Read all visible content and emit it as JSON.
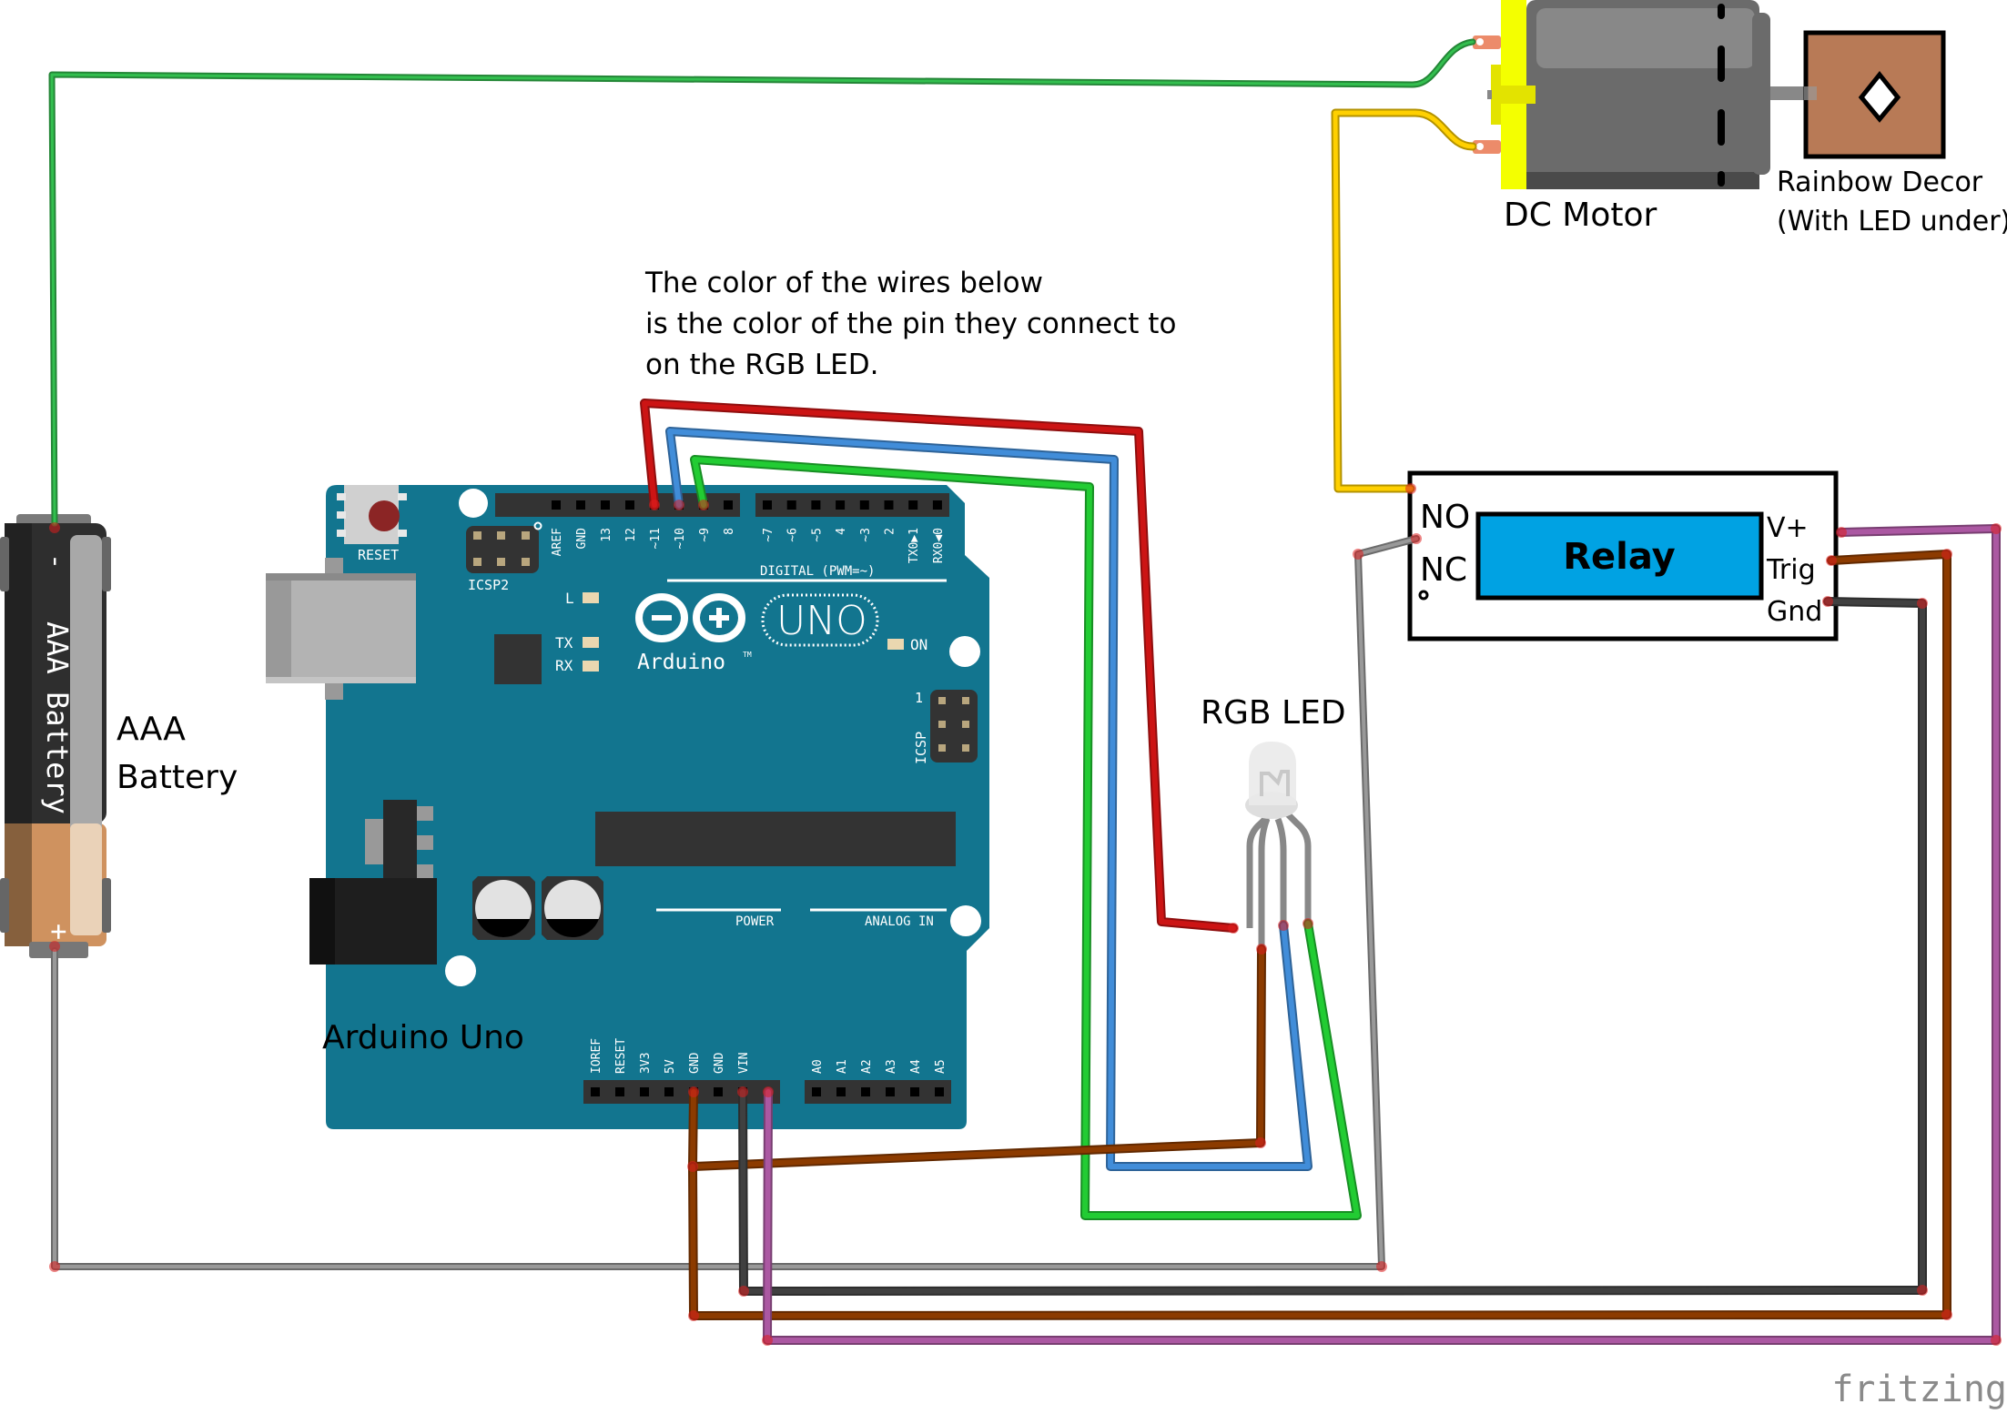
{
  "labels": {
    "note_line1": "The color of the wires below",
    "note_line2": "is the color of the pin they connect to",
    "note_line3": "on the RGB LED.",
    "dc_motor": "DC Motor",
    "rainbow_decor_line1": "Rainbow Decor",
    "rainbow_decor_line2": "(With LED under)",
    "aaa_line1": "AAA",
    "aaa_line2": "Battery",
    "battery_body": "AAA Battery",
    "battery_minus": "-",
    "battery_plus": "+",
    "rgb_led": "RGB LED",
    "arduino_uno": "Arduino Uno",
    "relay_title": "Relay",
    "relay_no": "NO",
    "relay_nc": "NC",
    "relay_vplus": "V+",
    "relay_trig": "Trig",
    "relay_gnd": "Gnd",
    "fritzing": "fritzing"
  },
  "arduino": {
    "reset": "RESET",
    "icsp2": "ICSP2",
    "icsp": "ICSP",
    "icsp_pin1": "1",
    "digital": "DIGITAL (PWM=~)",
    "power": "POWER",
    "analog": "ANALOG IN",
    "led_l": "L",
    "led_tx": "TX",
    "led_rx": "RX",
    "led_on": "ON",
    "brand": "Arduino",
    "tm": "TM",
    "model": "UNO",
    "top_pins_a": [
      "AREF",
      "GND",
      "13",
      "12",
      "~11",
      "~10",
      "~9",
      "8"
    ],
    "top_pins_b": [
      "~7",
      "~6",
      "~5",
      "4",
      "~3",
      "2",
      "TX0▶1",
      "RX0◀0"
    ],
    "power_pins": [
      "IOREF",
      "RESET",
      "3V3",
      "5V",
      "GND",
      "GND",
      "VIN"
    ],
    "analog_pins": [
      "A0",
      "A1",
      "A2",
      "A3",
      "A4",
      "A5"
    ]
  },
  "wires": [
    {
      "name": "battery-minus-to-motor-wire",
      "color": "#33bf4f"
    },
    {
      "name": "motor-to-relay-no-wire",
      "color": "#ffd000"
    },
    {
      "name": "relay-nc-to-battery-plus-wire",
      "color": "#999999"
    },
    {
      "name": "pin11-to-led-red-wire",
      "color": "#cc1414"
    },
    {
      "name": "pin10-to-led-blue-wire",
      "color": "#418dd9"
    },
    {
      "name": "pin9-to-led-green-wire",
      "color": "#22cc33"
    },
    {
      "name": "5v-to-led-common-wire",
      "color": "#8c3b00"
    },
    {
      "name": "5v-to-relay-trig-wire",
      "color": "#8c3b00"
    },
    {
      "name": "gnd-to-relay-gnd-wire",
      "color": "#404040"
    },
    {
      "name": "vin-to-relay-vplus-wire",
      "color": "#ab58a2"
    }
  ],
  "colors": {
    "board": "#12758f",
    "relay_fill": "#00a2e3",
    "decor_fill": "#b87a56",
    "motor_flange": "#f4ff00"
  }
}
